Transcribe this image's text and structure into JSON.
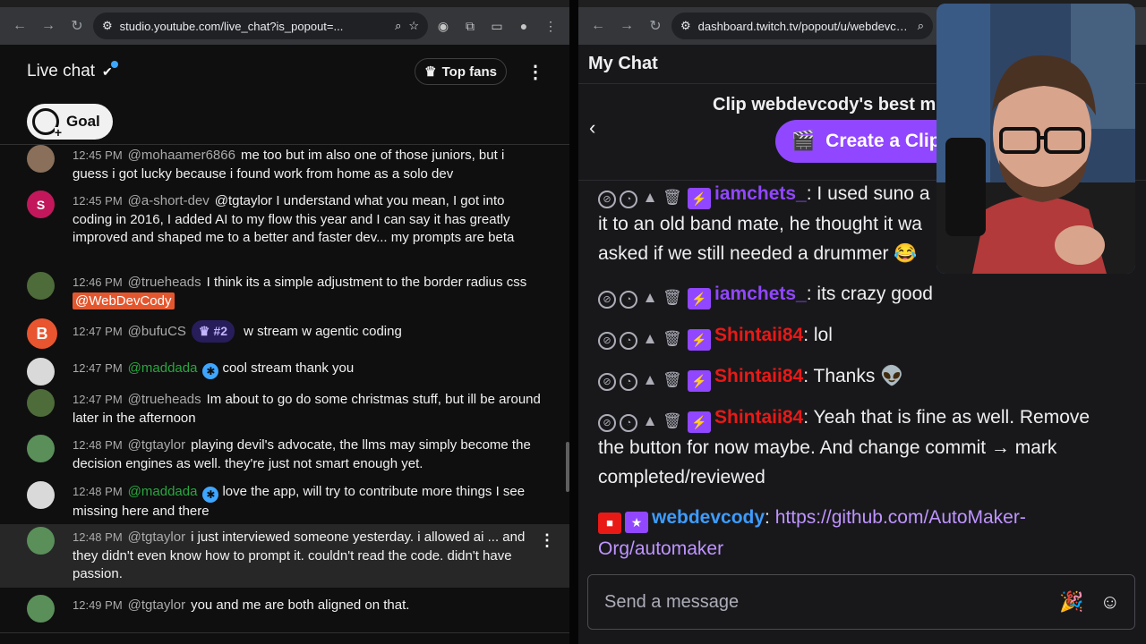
{
  "left_browser": {
    "url": "studio.youtube.com/live_chat?is_popout=..."
  },
  "youtube": {
    "title": "Live chat",
    "top_fans_label": "Top fans",
    "goal_label": "Goal",
    "messages": [
      {
        "time": "12:45 PM",
        "author": "@mohaamer6866",
        "text": "me too but im also one of those juniors, but i guess i got lucky because i found work from home as a solo dev",
        "avatar_color": "#8a6f5a",
        "avatar_letter": ""
      },
      {
        "time": "12:45 PM",
        "author": "@a-short-dev",
        "text": "@tgtaylor I understand what you mean, I got into coding in 2016, I added AI to my flow this year and I can say it has greatly improved and shaped me to a better and faster dev... my prompts are beta",
        "avatar_color": "#c2185b",
        "avatar_letter": "S"
      },
      {
        "time": "12:46 PM",
        "author": "@trueheads",
        "text": "I think its a simple adjustment to the border radius css",
        "mention": "@WebDevCody",
        "avatar_color": "#4e6b3a",
        "avatar_letter": ""
      },
      {
        "time": "12:47 PM",
        "author": "@bufuCS",
        "rank": "#2",
        "text": "w stream w agentic coding",
        "avatar_color": "#e8552f",
        "avatar_letter": "B"
      },
      {
        "time": "12:47 PM",
        "author": "@maddada",
        "text": "cool stream thank you",
        "avatar_color": "#d9d9d9",
        "avatar_letter": ""
      },
      {
        "time": "12:47 PM",
        "author": "@trueheads",
        "text": "Im about to go do some christmas stuff, but ill be around later in the afternoon",
        "avatar_color": "#4e6b3a",
        "avatar_letter": ""
      },
      {
        "time": "12:48 PM",
        "author": "@tgtaylor",
        "text": "playing devil's advocate, the llms may simply become the decision engines as well. they're just not smart enough yet.",
        "avatar_color": "#5a8f5a",
        "avatar_letter": ""
      },
      {
        "time": "12:48 PM",
        "author": "@maddada",
        "text": "love the app, will try to contribute more things I see missing here and there",
        "avatar_color": "#d9d9d9",
        "avatar_letter": ""
      },
      {
        "time": "12:48 PM",
        "author": "@tgtaylor",
        "text": "i just interviewed someone yesterday. i allowed ai ... and they didn't even know how to prompt it. couldn't read the code. didn't have passion.",
        "avatar_color": "#5a8f5a",
        "avatar_letter": ""
      },
      {
        "time": "12:49 PM",
        "author": "@tgtaylor",
        "text": "you and me are both aligned on that.",
        "avatar_color": "#5a8f5a",
        "avatar_letter": ""
      }
    ]
  },
  "right_browser": {
    "url": "dashboard.twitch.tv/popout/u/webdevcod..."
  },
  "twitch": {
    "header": "My Chat",
    "clip_title": "Clip webdevcody's best m",
    "clip_button": "Create a Clip",
    "messages": [
      {
        "author": "iamchets_",
        "color": "#9147ff",
        "text": "I used suno a",
        "cont": "it to an old band mate, he thought it wa",
        "cont2": "asked if we still needed a drummer 😂"
      },
      {
        "author": "iamchets_",
        "color": "#9147ff",
        "text": "its crazy good"
      },
      {
        "author": "Shintaii84",
        "color": "#e91916",
        "text": "lol"
      },
      {
        "author": "Shintaii84",
        "color": "#e91916",
        "text": "Thanks 👽"
      },
      {
        "author": "Shintaii84",
        "color": "#e91916",
        "text": "Yeah that is fine as well. Remove the button for now maybe. And change commit → mark completed/reviewed"
      },
      {
        "author": "webdevcody",
        "color": "#3d9cff",
        "link": "https://github.com/AutoMaker-Org/automaker"
      }
    ],
    "input_placeholder": "Send a message"
  }
}
